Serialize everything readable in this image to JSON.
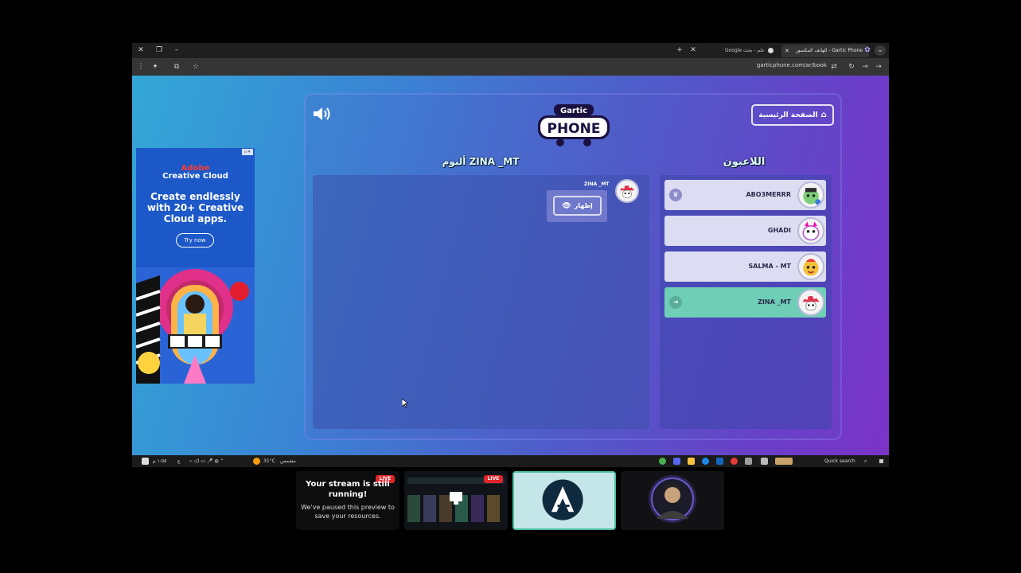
{
  "browser": {
    "tabs": [
      {
        "label": "Gartic Phone - الهاتف المكسور"
      },
      {
        "label": "علم - بحث Google"
      }
    ],
    "url": "garticphone.com/ar/book"
  },
  "ad": {
    "brand_line1": "Adobe",
    "brand_line2": "Creative Cloud",
    "headline": "Create endlessly with 20+ Creative Cloud apps.",
    "cta": "Try now"
  },
  "game": {
    "home_button": "الصفحة الرئيسية",
    "logo_top": "Gartic",
    "logo_bottom": "PHONE",
    "players_title": "اللاعبون",
    "album_title": "ألبوم ZINA _MT",
    "players": [
      {
        "name": "ABO3MERRR",
        "badge": "crown-icon"
      },
      {
        "name": "GHADI"
      },
      {
        "name": "SALMA - MT"
      },
      {
        "name": "ZINA _MT",
        "badge": "exit-icon",
        "is_me": true
      }
    ],
    "message": {
      "author": "ZINA _MT",
      "show_label": "إظهار"
    }
  },
  "taskbar": {
    "search": "Quick search",
    "weather_temp": "31°C",
    "weather_label": "مشمس",
    "lang": "ع",
    "clock": "١:٥٥ م"
  },
  "stream": {
    "paused_title": "Your stream is still running!",
    "paused_sub": "We've paused this preview to save your resources.",
    "live_badge": "LIVE"
  },
  "colors": {
    "accent_green": "#6ecfb6",
    "live_red": "#e3242b"
  }
}
